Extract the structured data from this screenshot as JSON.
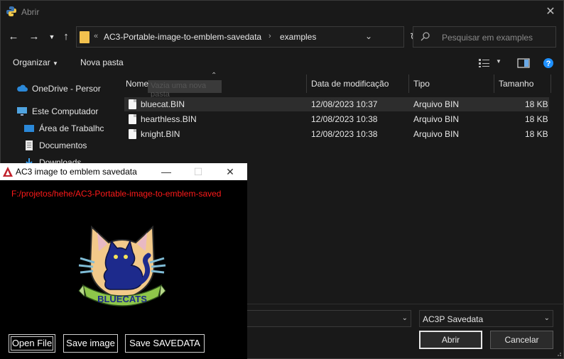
{
  "dialog": {
    "title": "Abrir",
    "address": {
      "overflow": "«",
      "crumbs": [
        "AC3-Portable-image-to-emblem-savedata",
        "examples"
      ]
    },
    "search_placeholder": "Pesquisar em examples",
    "toolbar": {
      "organize": "Organizar",
      "new_folder": "Nova pasta"
    },
    "sidebar": {
      "items": [
        {
          "label": "OneDrive - Persor",
          "icon": "cloud-icon"
        },
        {
          "label": "Este Computador",
          "icon": "computer-icon"
        },
        {
          "label": "Área de Trabalhc",
          "icon": "desktop-icon"
        },
        {
          "label": "Documentos",
          "icon": "documents-icon"
        },
        {
          "label": "Downloads",
          "icon": "downloads-icon"
        }
      ]
    },
    "columns": {
      "name": "Nome",
      "modified": "Data de modificação",
      "type": "Tipo",
      "size": "Tamanho"
    },
    "ghost_tooltip": "Vazia uma nova pasta",
    "files": [
      {
        "name": "bluecat.BIN",
        "modified": "12/08/2023 10:37",
        "type": "Arquivo BIN",
        "size": "18 KB"
      },
      {
        "name": "hearthless.BIN",
        "modified": "12/08/2023 10:38",
        "type": "Arquivo BIN",
        "size": "18 KB"
      },
      {
        "name": "knight.BIN",
        "modified": "12/08/2023 10:38",
        "type": "Arquivo BIN",
        "size": "18 KB"
      }
    ],
    "file_type_filter": "AC3P Savedata",
    "buttons": {
      "open": "Abrir",
      "cancel": "Cancelar"
    }
  },
  "app": {
    "title": "AC3 image to emblem savedata",
    "path": "F:/projetos/hehe/AC3-Portable-image-to-emblem-saved",
    "emblem_text": "BLUECATS",
    "buttons": {
      "open_file": "Open File",
      "save_image": "Save image",
      "save_savedata": "Save SAVEDATA"
    }
  },
  "colors": {
    "path_text": "#ff1a1a",
    "folder": "#f2c14e",
    "accent_blue": "#1e90ff"
  }
}
